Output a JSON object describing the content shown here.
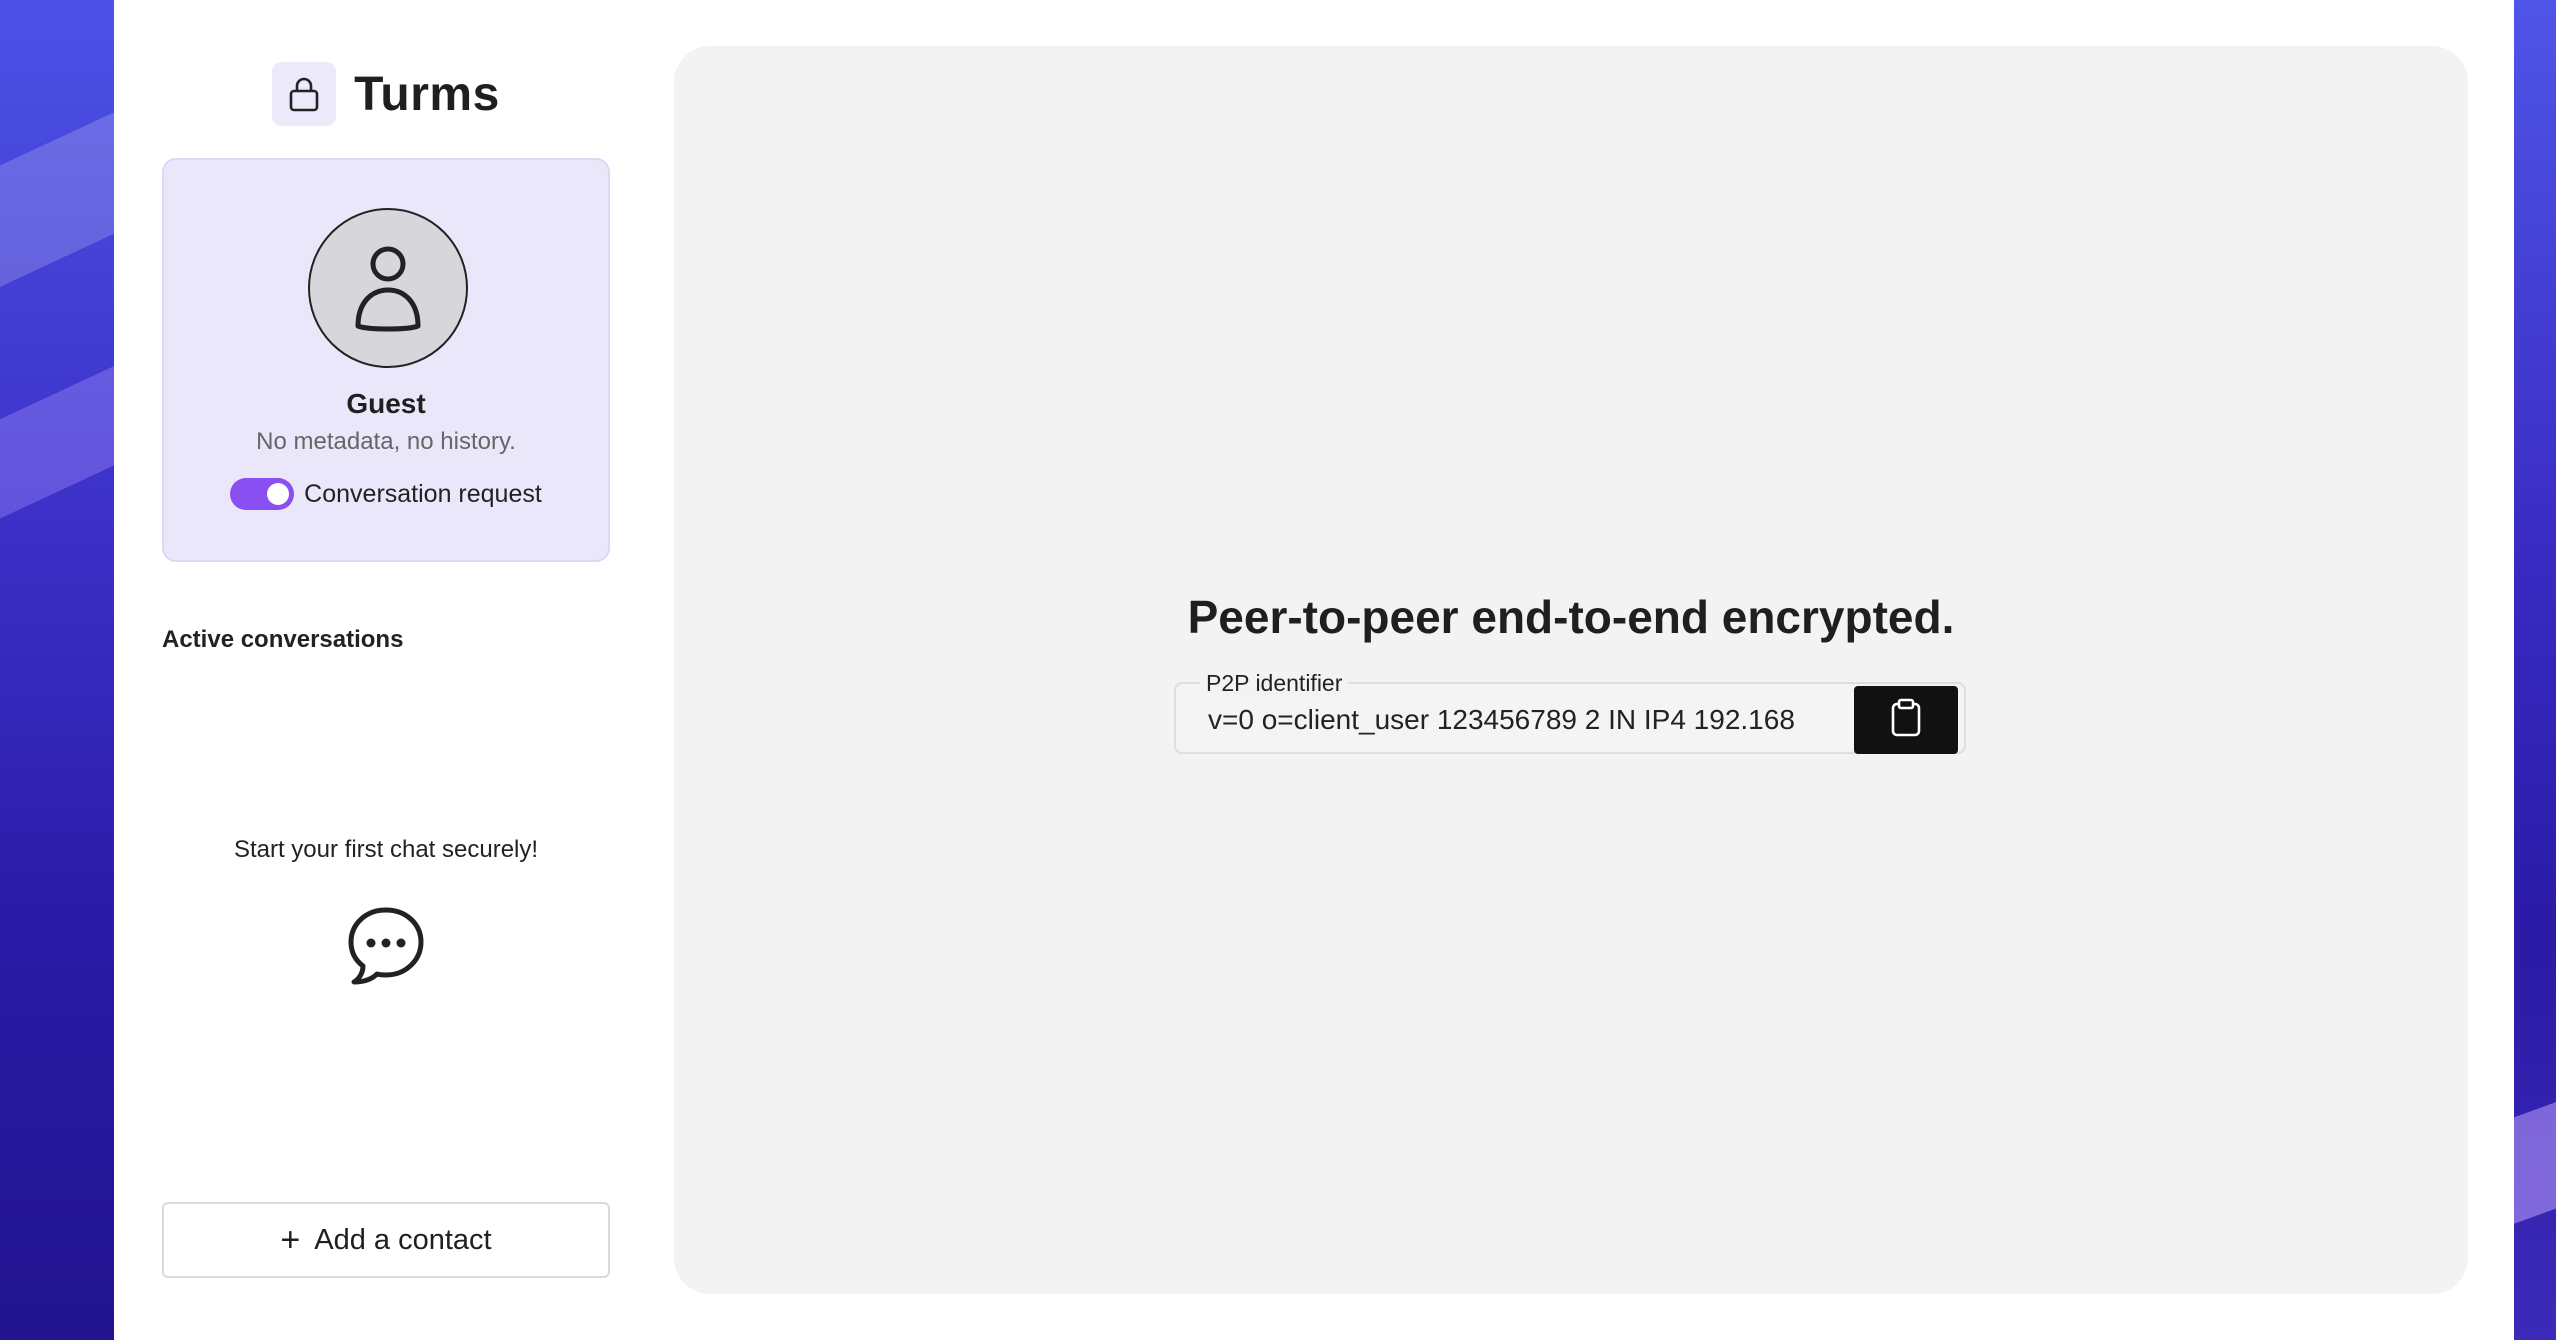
{
  "app": {
    "title": "Turms",
    "brand_icon": "lock-icon"
  },
  "profile": {
    "avatar_icon": "user-icon",
    "name": "Guest",
    "meta": "No metadata, no history.",
    "conversation_request": {
      "label": "Conversation request",
      "enabled": true,
      "accent_color": "#8a4ff0"
    }
  },
  "sidebar": {
    "section_title": "Active conversations",
    "empty_state": {
      "text": "Start your first chat securely!",
      "icon": "chat-bubble-icon"
    },
    "add_contact": {
      "icon": "plus-icon",
      "label": "Add a contact"
    }
  },
  "main": {
    "heading": "Peer-to-peer end-to-end encrypted.",
    "p2p": {
      "label": "P2P identifier",
      "value": "v=0 o=client_user 123456789 2 IN IP4 192.168",
      "copy_icon": "clipboard-icon"
    }
  }
}
